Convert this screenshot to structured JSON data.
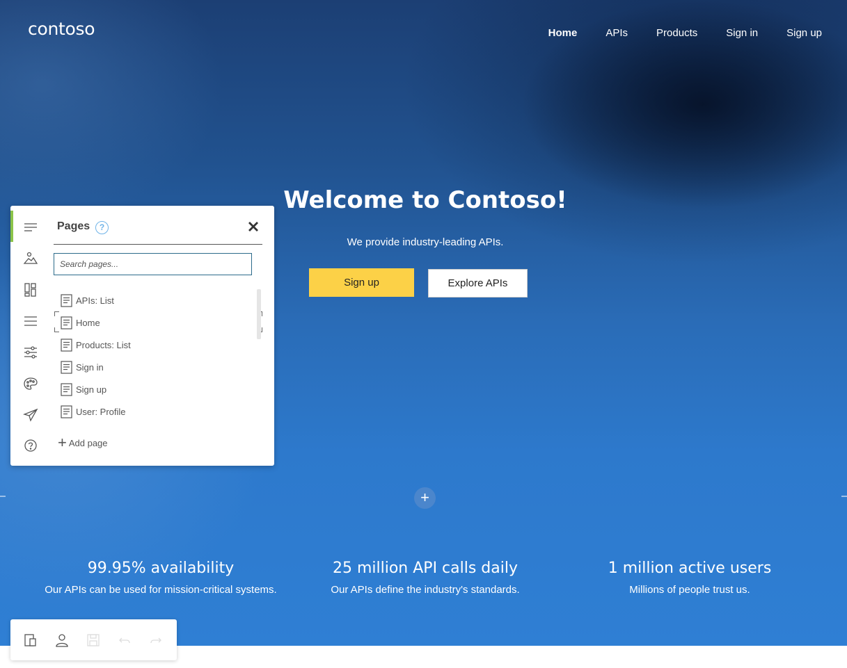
{
  "brand": {
    "logo": "contoso"
  },
  "nav": {
    "items": [
      "Home",
      "APIs",
      "Products",
      "Sign in",
      "Sign up"
    ],
    "active": "Home"
  },
  "hero": {
    "title": "Welcome to Contoso!",
    "subtitle": "We provide industry-leading APIs.",
    "primary_button": "Sign up",
    "secondary_button": "Explore APIs",
    "add_section_icon": "+"
  },
  "stats": [
    {
      "title": "99.95% availability",
      "desc": "Our APIs can be used for mission-critical systems."
    },
    {
      "title": "25 million API calls daily",
      "desc": "Our APIs define the industry's standards."
    },
    {
      "title": "1 million active users",
      "desc": "Millions of people trust us."
    }
  ],
  "pages_panel": {
    "title": "Pages",
    "help": "?",
    "search_placeholder": "Search pages...",
    "pages": [
      "APIs: List",
      "Home",
      "Products: List",
      "Sign in",
      "Sign up",
      "User: Profile"
    ],
    "selected": "Home",
    "add_page": "Add page"
  },
  "side_rail": [
    "pages-icon",
    "media-icon",
    "layouts-icon",
    "navigation-icon",
    "settings-icon",
    "styles-icon",
    "publish-icon",
    "help-icon"
  ],
  "toolbar": [
    "viewport-icon",
    "user-icon",
    "save-icon",
    "undo-icon",
    "redo-icon"
  ],
  "colors": {
    "accent_yellow": "#fcd147",
    "active_green": "#8bc34a",
    "help_blue": "#6fb3e8"
  }
}
